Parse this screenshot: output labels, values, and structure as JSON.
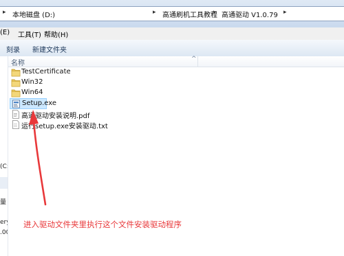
{
  "breadcrumbs": [
    {
      "label": "本地磁盘 (D:)"
    },
    {
      "label": "高通刷机工具教程"
    },
    {
      "label": "高通驱动 V1.0.79"
    }
  ],
  "menu": {
    "items": [
      {
        "label": "(E)"
      },
      {
        "label": "工具(T)"
      },
      {
        "label": "帮助(H)"
      }
    ]
  },
  "toolbar": {
    "burn_label": "刻录",
    "new_folder_label": "新建文件夹"
  },
  "list": {
    "column_name": "名称",
    "items": [
      {
        "name": "TestCertificate",
        "type": "folder"
      },
      {
        "name": "Win32",
        "type": "folder"
      },
      {
        "name": "Win64",
        "type": "folder"
      },
      {
        "name": "Setup.exe",
        "type": "exe"
      },
      {
        "name": "高通驱动安装说明.pdf",
        "type": "pdf"
      },
      {
        "name": "运行setup.exe安装驱动.txt",
        "type": "txt"
      }
    ]
  },
  "navpane": {
    "fragments": [
      "(C:",
      "量 (I",
      "ery",
      ".00"
    ]
  },
  "annotation": {
    "text": "进入驱动文件夹里执行这个文件安装驱动程序",
    "color": "#e8383a"
  },
  "colors": {
    "selection": "#cce8ff",
    "folder": "#e8c55a",
    "annotation": "#e8383a"
  }
}
